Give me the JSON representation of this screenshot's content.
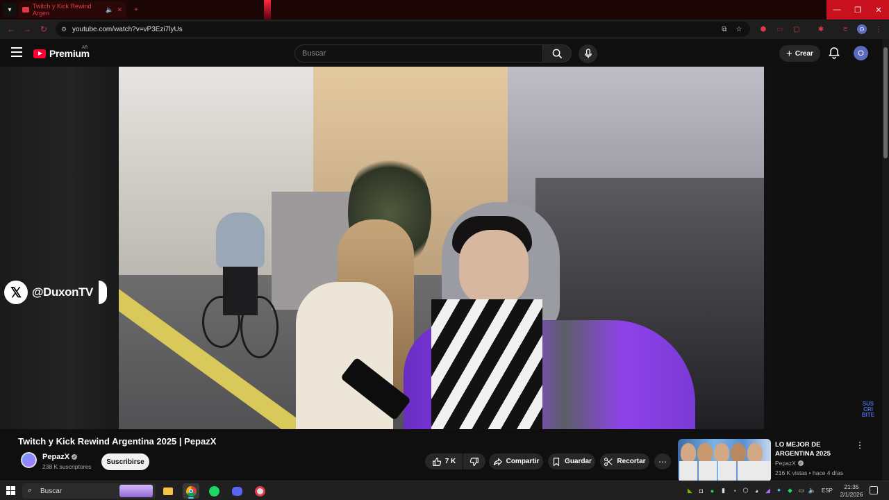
{
  "browser": {
    "tab_title": "Twitch y Kick Rewind Argen",
    "url": "youtube.com/watch?v=vP3Ezi7lyUs",
    "window_controls": [
      "—",
      "❐",
      "✕"
    ],
    "new_tab_label": "+",
    "accent_color": "#e0394a"
  },
  "header": {
    "logo_text": "Premium",
    "region": "AR",
    "search_placeholder": "Buscar",
    "create_label": "Crear",
    "avatar_letter": "O"
  },
  "video": {
    "overlay_handle": "@DuxonTV",
    "overlay_corner": [
      "SUS",
      "CRI",
      "BITE"
    ],
    "title": "Twitch y Kick Rewind Argentina 2025 | PepazX"
  },
  "channel": {
    "name": "PepazX",
    "subscribers": "238 K suscriptores",
    "subscribe_label": "Suscribirse"
  },
  "actions": {
    "likes": "7 K",
    "share_label": "Compartir",
    "save_label": "Guardar",
    "clip_label": "Recortar"
  },
  "recommendation": {
    "title": "LO MEJOR DE ARGENTINA 2025",
    "channel": "PepazX",
    "meta": "216 K vistas • hace 4 días"
  },
  "taskbar": {
    "search_label": "Buscar",
    "language": "ESP",
    "time": "21:35",
    "date": "2/1/2026"
  }
}
